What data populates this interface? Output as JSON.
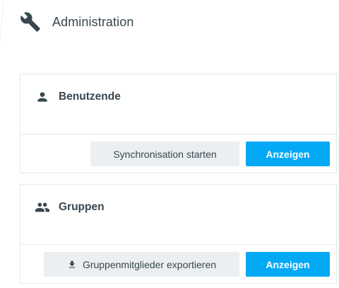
{
  "header": {
    "title": "Administration",
    "icon": "wrench-icon"
  },
  "cards": [
    {
      "title": "Benutzende",
      "icon": "person-icon",
      "secondary_button": "Synchronisation starten",
      "primary_button": "Anzeigen"
    },
    {
      "title": "Gruppen",
      "icon": "group-icon",
      "secondary_button": "Gruppenmitglieder exportieren",
      "secondary_button_icon": "download-icon",
      "primary_button": "Anzeigen"
    }
  ],
  "colors": {
    "primary": "#03a9f4",
    "secondary_bg": "#eceff1",
    "text": "#37474f",
    "border": "#e6e9eb"
  }
}
